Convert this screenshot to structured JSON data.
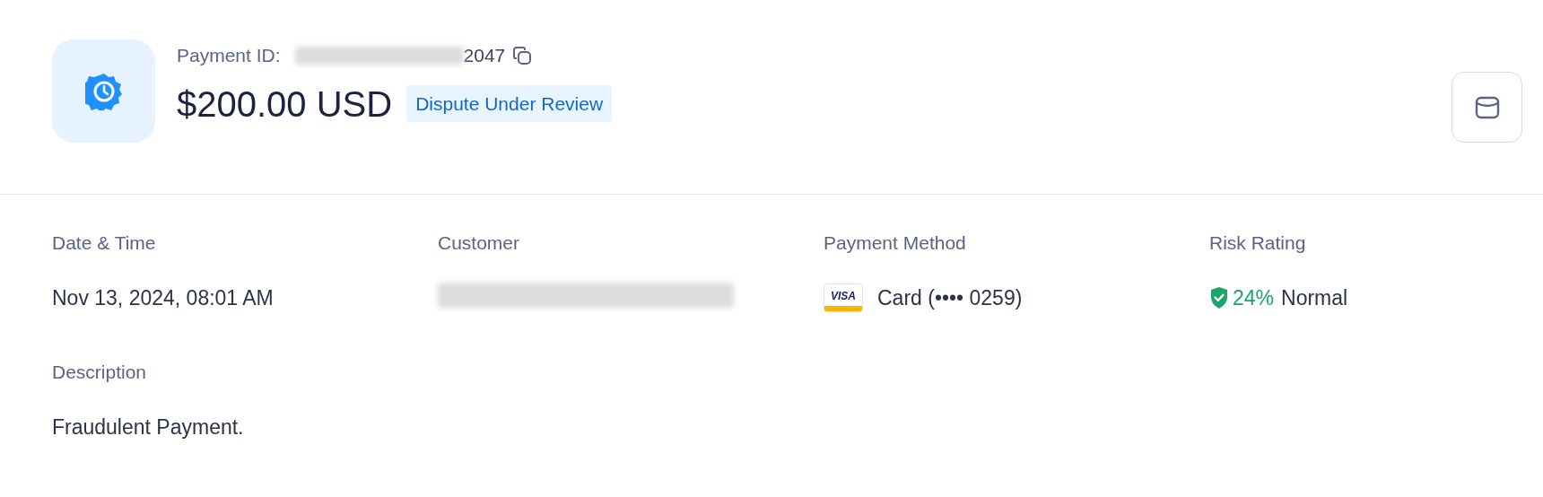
{
  "header": {
    "payment_id_label": "Payment ID:",
    "payment_id_suffix": "2047",
    "amount": "$200.00 USD",
    "status": "Dispute Under Review"
  },
  "fields": [
    {
      "kind": "text",
      "label": "Date & Time",
      "value": "Nov 13, 2024, 08:01 AM"
    },
    {
      "kind": "redacted",
      "label": "Customer"
    },
    {
      "kind": "card",
      "label": "Payment Method",
      "brand": "VISA",
      "value": "Card (•••• 0259)"
    },
    {
      "kind": "risk",
      "label": "Risk Rating",
      "score": "24%",
      "value": "Normal"
    }
  ],
  "description": {
    "label": "Description",
    "value": "Fraudulent Payment."
  }
}
